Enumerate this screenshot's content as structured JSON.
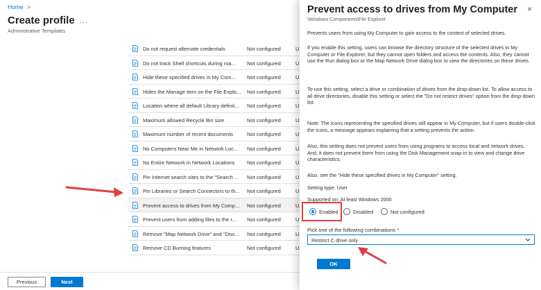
{
  "breadcrumb": "Home",
  "breadcrumb_sep": ">",
  "page_title": "Create profile",
  "page_more": "...",
  "page_subtitle": "Administrative Templates",
  "settings": [
    {
      "name": "Do not request alternate credentials",
      "state": "Not configured",
      "extra": "U"
    },
    {
      "name": "Do not track Shell shortcuts during roa...",
      "state": "Not configured",
      "extra": "U"
    },
    {
      "name": "Hide these specified drives in My Com...",
      "state": "Not configured",
      "extra": "U"
    },
    {
      "name": "Hides the Manage item on the File Explo...",
      "state": "Not configured",
      "extra": "U"
    },
    {
      "name": "Location where all default Library definit...",
      "state": "Not configured",
      "extra": "U"
    },
    {
      "name": "Maximum allowed Recycle Bin size",
      "state": "Not configured",
      "extra": "U"
    },
    {
      "name": "Maximum number of recent documents",
      "state": "Not configured",
      "extra": "U"
    },
    {
      "name": "No Computers Near Me in Network Loc...",
      "state": "Not configured",
      "extra": "U"
    },
    {
      "name": "No Entire Network in Network Locations",
      "state": "Not configured",
      "extra": "U"
    },
    {
      "name": "Pin Internet search sites to the \"Search ...",
      "state": "Not configured",
      "extra": "U"
    },
    {
      "name": "Pin Libraries or Search Connectors to th...",
      "state": "Not configured",
      "extra": "U"
    },
    {
      "name": "Prevent access to drives from My Comp...",
      "state": "Not configured",
      "extra": "U"
    },
    {
      "name": "Prevent users from adding files to the r...",
      "state": "Not configured",
      "extra": "U"
    },
    {
      "name": "Remove \"Map Network Drive\" and \"Disc...",
      "state": "Not configured",
      "extra": "U"
    },
    {
      "name": "Remove CD Burning features",
      "state": "Not configured",
      "extra": "U"
    }
  ],
  "selected_index": 11,
  "footer": {
    "previous": "Previous",
    "next": "Next"
  },
  "panel": {
    "title": "Prevent access to drives from My Computer",
    "close": "×",
    "path": "\\Windows Components\\File Explorer",
    "paragraphs": [
      "Prevents users from using My Computer to gain access to the content of selected drives.",
      "If you enable this setting, users can browse the directory structure of the selected drives in My Computer or File Explorer, but they cannot open folders and access the contents. Also, they cannot use the Run dialog box or the Map Network Drive dialog box to view the directories on these drives.",
      "To use this setting, select a drive or combination of drives from the drop-down list. To allow access to all drive directories, disable this setting or select the \"Do not restrict drives\" option from the drop-down list.",
      "Note: The icons representing the specified drives still appear in My Computer, but if users double-click the icons, a message appears explaining that a setting prevents the action.",
      " Also, this setting does not prevent users from using programs to access local and network drives. And, it does not prevent them from using the Disk Management snap-in to view and change drive characteristics.",
      "Also, see the \"Hide these specified drives in My Computer\" setting.",
      "Setting type: User",
      "Supported on: At least Windows 2000"
    ],
    "radios": [
      {
        "label": "Enabled",
        "selected": true
      },
      {
        "label": "Disabled",
        "selected": false
      },
      {
        "label": "Not configured",
        "selected": false
      }
    ],
    "pick_label": "Pick one of the following combinations",
    "pick_required": "*",
    "pick_value": "Restrict C drive only",
    "ok": "OK"
  },
  "colors": {
    "accent": "#0078d4",
    "annotation": "#e03e3e"
  },
  "icons": [
    "document-icon",
    "chevron-down-icon",
    "close-icon",
    "more-icon"
  ]
}
